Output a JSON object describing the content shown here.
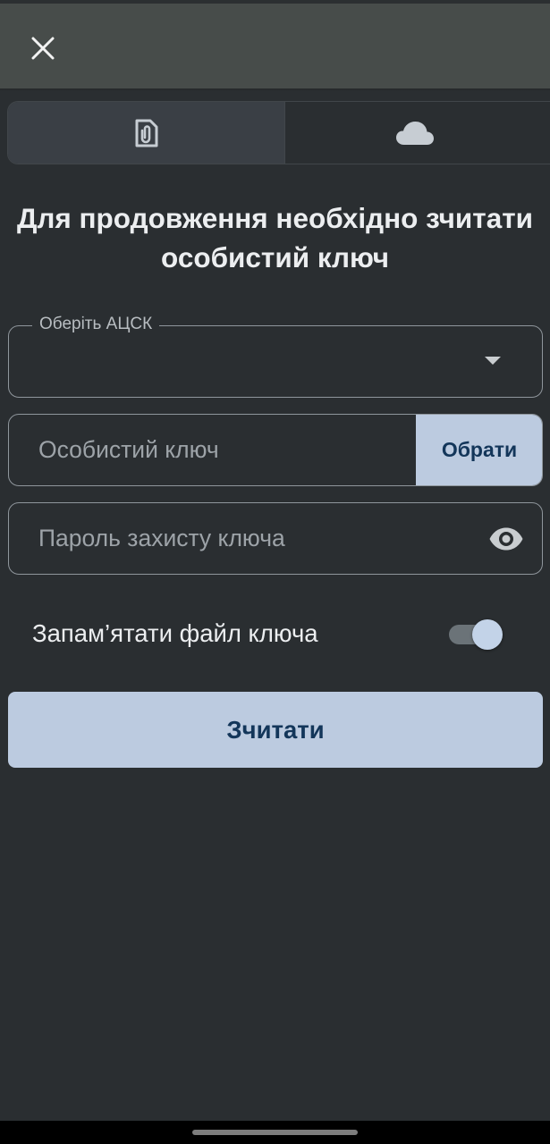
{
  "header": {
    "close_icon": "close-icon"
  },
  "tabs": [
    {
      "id": "file",
      "icon": "file-attachment-icon",
      "selected": true
    },
    {
      "id": "cloud",
      "icon": "cloud-icon",
      "selected": false
    }
  ],
  "title": "Для продовження необхідно зчитати особистий ключ",
  "form": {
    "ca_label": "Оберіть АЦСК",
    "ca_value": "",
    "key_placeholder": "Особистий ключ",
    "choose_label": "Обрати",
    "password_placeholder": "Пароль захисту ключа",
    "remember_label": "Запам’ятати файл ключа",
    "remember_enabled": true,
    "submit_label": "Зчитати"
  },
  "colors": {
    "background": "#2a2e31",
    "appbar": "#474c4a",
    "accent_button": "#bccbe0",
    "accent_text": "#13365a"
  }
}
